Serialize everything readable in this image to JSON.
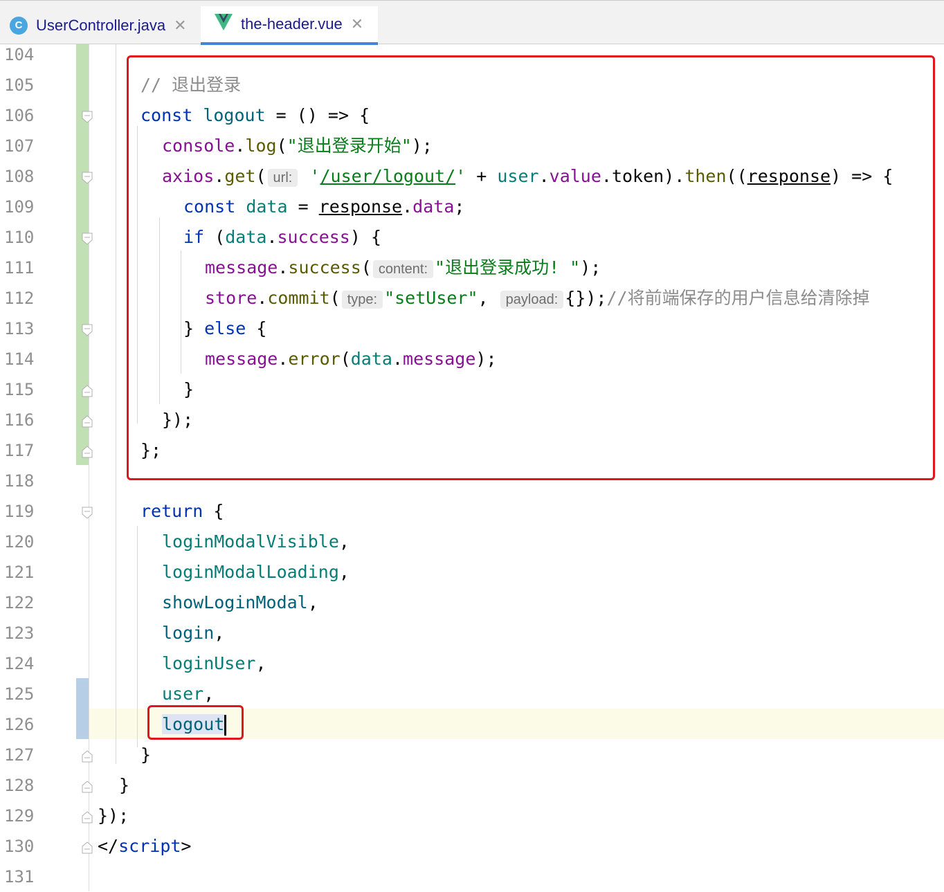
{
  "tabs": [
    {
      "label": "UserController.java",
      "icon": "class-icon",
      "icon_text": "C",
      "active": false
    },
    {
      "label": "the-header.vue",
      "icon": "vue-icon",
      "active": true
    }
  ],
  "line_numbers": [
    "104",
    "105",
    "106",
    "107",
    "108",
    "109",
    "110",
    "111",
    "112",
    "113",
    "114",
    "115",
    "116",
    "117",
    "118",
    "119",
    "120",
    "121",
    "122",
    "123",
    "124",
    "125",
    "126",
    "127",
    "128",
    "129",
    "130",
    "131"
  ],
  "code": {
    "l105": "// 退出登录",
    "l106": {
      "a": "const ",
      "b": "logout",
      "c": " = () => {"
    },
    "l107": {
      "a": "console",
      "b": ".",
      "c": "log",
      "d": "(",
      "e": "\"退出登录开始\"",
      "f": ");"
    },
    "l108": {
      "a": "axios",
      "b": ".",
      "c": "get",
      "d": "(",
      "hint": "url:",
      "e": "'",
      "f": "/user/logout/",
      "g": "'",
      "h": " + ",
      "i": "user",
      "j": ".",
      "k": "value",
      "l": ".token).",
      "m": "then",
      "n": "((",
      "o": "response",
      "p": ") => {"
    },
    "l109": {
      "a": "const ",
      "b": "data",
      "c": " = ",
      "d": "response",
      "e": ".",
      "f": "data",
      "g": ";"
    },
    "l110": {
      "a": "if ",
      "b": "(",
      "c": "data",
      "d": ".",
      "e": "success",
      "f": ") {"
    },
    "l111": {
      "a": "message",
      "b": ".",
      "c": "success",
      "d": "(",
      "hint": "content:",
      "e": "\"退出登录成功! \"",
      "f": ");"
    },
    "l112": {
      "a": "store",
      "b": ".",
      "c": "commit",
      "d": "(",
      "hint1": "type:",
      "e": "\"setUser\"",
      "f": ", ",
      "hint2": "payload:",
      "g": "{});",
      "h": "//将前端保存的用户信息给清除掉"
    },
    "l113": {
      "a": "} ",
      "b": "else",
      "c": " {"
    },
    "l114": {
      "a": "message",
      "b": ".",
      "c": "error",
      "d": "(",
      "e": "data",
      "f": ".",
      "g": "message",
      "h": ");"
    },
    "l115": "}",
    "l116": "});",
    "l117": "};",
    "l119": {
      "a": "return",
      "b": " {"
    },
    "l120": "loginModalVisible",
    "l121": "loginModalLoading",
    "l122": "showLoginModal",
    "l123": "login",
    "l124": "loginUser",
    "l125": "user",
    "l126": "logout",
    "l127": "}",
    "l128": "}",
    "l129": "});",
    "l130": {
      "a": "</",
      "b": "script",
      "c": ">"
    },
    "comma": ","
  },
  "colors": {
    "highlight_box": "#e0161f",
    "vcs_added": "#c1e0b4",
    "vcs_modified": "#b7cfe6",
    "tab_underline": "#3f86d9"
  }
}
